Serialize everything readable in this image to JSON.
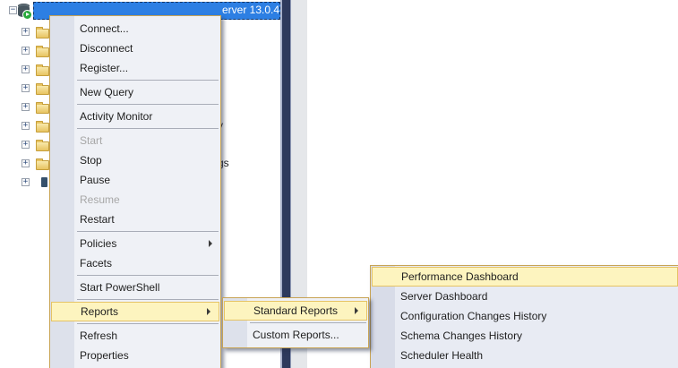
{
  "icons": {
    "collapse_glyph": "−",
    "expand_glyph": "+",
    "server_icon": "database-cylinder-with-green-connected-badge",
    "folder_icon": "yellow-folder",
    "submenu_arrow": "right-triangle"
  },
  "colors": {
    "selection_blue": "#2D7FE3",
    "menu_background": "#EFF1F6",
    "menu_gutter": "#DDE1EB",
    "menu_border_gold": "#C8A455",
    "highlight_bg": "#FDF4BF",
    "highlight_border": "#E5C365",
    "shell_splitter_navy": "#2E3A5D",
    "disabled_text": "#A7A7A7"
  },
  "object_explorer": {
    "server_node": {
      "selected": true,
      "visible_label_fragment": "erver 13.0.4"
    },
    "tree_rows": [
      {
        "expander": "+",
        "visible_text_fragment": ""
      },
      {
        "expander": "+",
        "visible_text_fragment": ""
      },
      {
        "expander": "+",
        "visible_text_fragment": ""
      },
      {
        "expander": "+",
        "visible_text_fragment": ""
      },
      {
        "expander": "+",
        "visible_text_fragment": ""
      },
      {
        "expander": "+",
        "visible_text_fragment": "y"
      },
      {
        "expander": "+",
        "visible_text_fragment": ""
      },
      {
        "expander": "+",
        "visible_text_fragment": "gs"
      },
      {
        "expander": "+",
        "visible_text_fragment": ""
      }
    ]
  },
  "context_menu": {
    "items": [
      {
        "type": "item",
        "label": "Connect...",
        "enabled": true
      },
      {
        "type": "item",
        "label": "Disconnect",
        "enabled": true
      },
      {
        "type": "item",
        "label": "Register...",
        "enabled": true
      },
      {
        "type": "separator"
      },
      {
        "type": "item",
        "label": "New Query",
        "enabled": true
      },
      {
        "type": "separator"
      },
      {
        "type": "item",
        "label": "Activity Monitor",
        "enabled": true
      },
      {
        "type": "separator"
      },
      {
        "type": "item",
        "label": "Start",
        "enabled": false
      },
      {
        "type": "item",
        "label": "Stop",
        "enabled": true
      },
      {
        "type": "item",
        "label": "Pause",
        "enabled": true
      },
      {
        "type": "item",
        "label": "Resume",
        "enabled": false
      },
      {
        "type": "item",
        "label": "Restart",
        "enabled": true
      },
      {
        "type": "separator"
      },
      {
        "type": "item",
        "label": "Policies",
        "enabled": true,
        "has_submenu": true
      },
      {
        "type": "item",
        "label": "Facets",
        "enabled": true
      },
      {
        "type": "separator"
      },
      {
        "type": "item",
        "label": "Start PowerShell",
        "enabled": true
      },
      {
        "type": "separator"
      },
      {
        "type": "item",
        "label": "Reports",
        "enabled": true,
        "has_submenu": true,
        "highlighted": true
      },
      {
        "type": "separator"
      },
      {
        "type": "item",
        "label": "Refresh",
        "enabled": true
      },
      {
        "type": "item",
        "label": "Properties",
        "enabled": true
      }
    ]
  },
  "reports_submenu": {
    "items": [
      {
        "type": "item",
        "label": "Standard Reports",
        "enabled": true,
        "has_submenu": true,
        "highlighted": true
      },
      {
        "type": "separator"
      },
      {
        "type": "item",
        "label": "Custom Reports...",
        "enabled": true
      }
    ]
  },
  "standard_reports_submenu": {
    "items": [
      {
        "type": "item",
        "label": "Performance Dashboard",
        "enabled": true,
        "highlighted": true
      },
      {
        "type": "item",
        "label": "Server Dashboard",
        "enabled": true
      },
      {
        "type": "item",
        "label": "Configuration Changes History",
        "enabled": true
      },
      {
        "type": "item",
        "label": "Schema Changes History",
        "enabled": true
      },
      {
        "type": "item",
        "label": "Scheduler Health",
        "enabled": true
      }
    ]
  }
}
